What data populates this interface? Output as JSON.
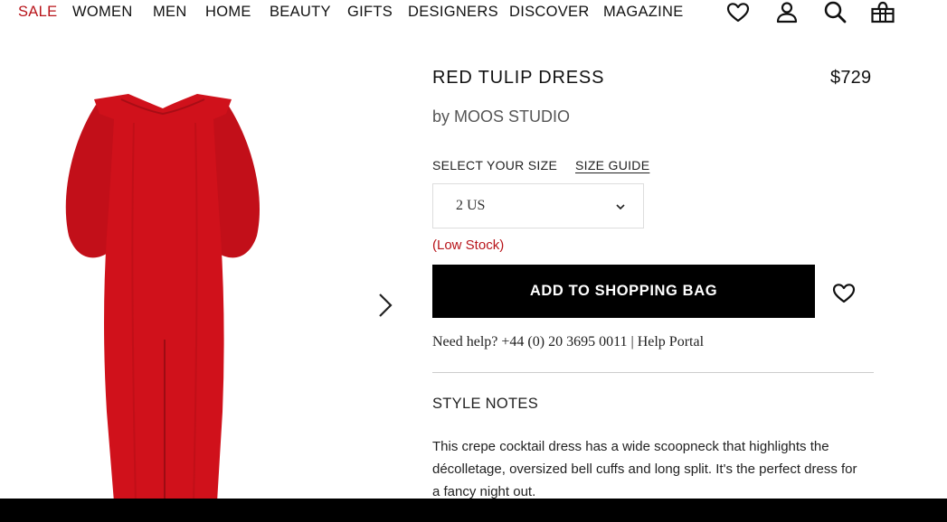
{
  "nav": {
    "items": [
      {
        "label": "SALE"
      },
      {
        "label": "WOMEN"
      },
      {
        "label": "MEN"
      },
      {
        "label": "HOME"
      },
      {
        "label": "BEAUTY"
      },
      {
        "label": "GIFTS"
      },
      {
        "label": "DESIGNERS"
      },
      {
        "label": "DISCOVER"
      },
      {
        "label": "MAGAZINE"
      }
    ],
    "icons": [
      "heart-icon",
      "user-icon",
      "search-icon",
      "shopping-bag-icon"
    ]
  },
  "product": {
    "title": "RED TULIP DRESS",
    "price": "$729",
    "designer": "by MOOS STUDIO",
    "size_label": "SELECT YOUR SIZE",
    "size_guide": "SIZE GUIDE",
    "selected_size": "2 US",
    "stock": "(Low Stock)",
    "add_to_bag": "ADD TO SHOPPING BAG",
    "help_text": "Need help? +44 (0) 20 3695 0011 | Help Portal",
    "style_notes_heading": "STYLE NOTES",
    "description": "This crepe cocktail dress has a wide scoopneck that highlights the décolletage, oversized bell cuffs and long split. It's the perfect dress for a fancy night out."
  },
  "colors": {
    "sale": "#b8141a",
    "dress": "#d0111b",
    "button": "#000000",
    "stock": "#b8141a"
  }
}
